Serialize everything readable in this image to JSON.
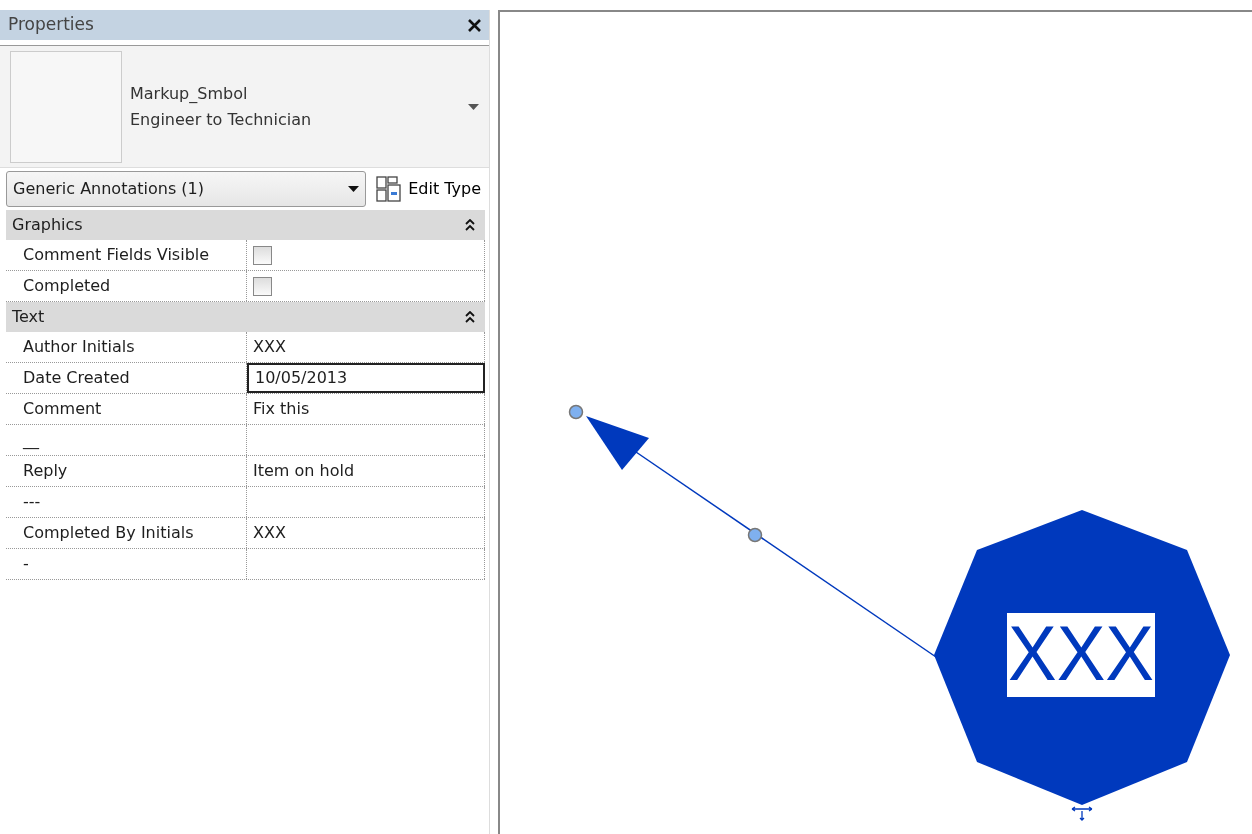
{
  "panel": {
    "title": "Properties"
  },
  "type_selector": {
    "family": "Markup_Smbol",
    "type": "Engineer to Technician"
  },
  "category_dropdown": {
    "value": "Generic Annotations (1)"
  },
  "edit_type": {
    "label": "Edit Type"
  },
  "sections": [
    {
      "title": "Graphics",
      "expanded": true,
      "rows": [
        {
          "label": "Comment Fields Visible",
          "kind": "checkbox",
          "checked": false
        },
        {
          "label": "Completed",
          "kind": "checkbox",
          "checked": false
        }
      ]
    },
    {
      "title": "Text",
      "expanded": true,
      "rows": [
        {
          "label": "Author Initials",
          "kind": "text",
          "value": "XXX",
          "selected": false
        },
        {
          "label": "Date Created",
          "kind": "text",
          "value": "10/05/2013",
          "selected": true
        },
        {
          "label": "Comment",
          "kind": "text",
          "value": "Fix this",
          "selected": false
        },
        {
          "label": "__",
          "kind": "text",
          "selected": false
        },
        {
          "label": "Reply",
          "kind": "text",
          "value": "Item on hold",
          "selected": false
        },
        {
          "label": "---",
          "kind": "text",
          "selected": false
        },
        {
          "label": "Completed By Initials",
          "kind": "text",
          "value": "XXX",
          "selected": false
        },
        {
          "label": "-",
          "kind": "text",
          "selected": false
        }
      ]
    }
  ],
  "canvas": {
    "tag_text": "XXX"
  }
}
